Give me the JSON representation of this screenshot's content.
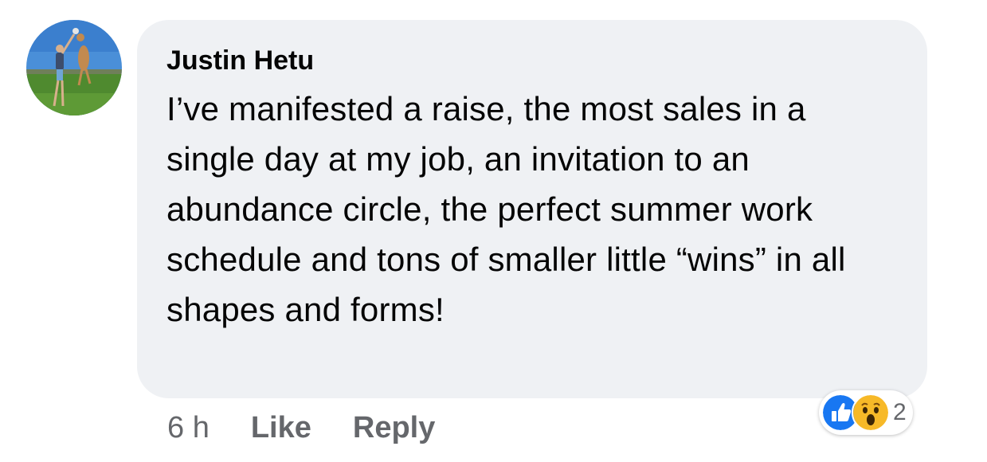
{
  "comment": {
    "author": "Justin Hetu",
    "text": "I’ve manifested a raise, the most sales in a single day at my job, an invitation to an abundance circle, the perfect summer work schedule and tons of smaller little “wins” in all shapes and forms!",
    "time": "6 h",
    "like_label": "Like",
    "reply_label": "Reply"
  },
  "reactions": {
    "icons": [
      "like-icon",
      "wow-icon"
    ],
    "count": "2",
    "colors": {
      "like": "#1877f2",
      "wow": "#f7b928"
    }
  },
  "colors": {
    "bubble": "#eff1f4",
    "text": "#050505",
    "secondary": "#65676b"
  }
}
